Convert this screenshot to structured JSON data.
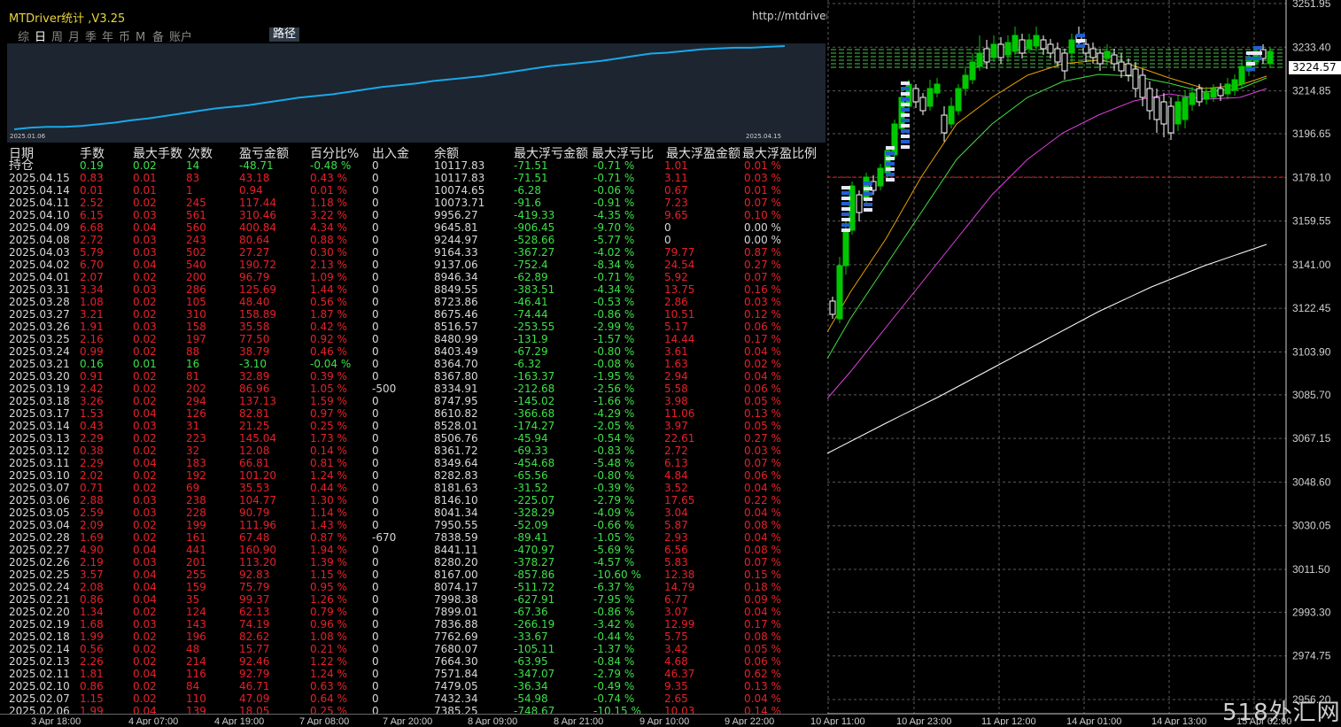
{
  "panel": {
    "title": "MTDriver统计 ,V3.25",
    "url": "http://mtdriver.cn",
    "tabs": [
      "综",
      "日",
      "周",
      "月",
      "季",
      "年",
      "币",
      "M",
      "备",
      "账户"
    ],
    "active_tab": "日",
    "path_button": "路径",
    "equity": {
      "start_date": "2025.01.06",
      "end_date": "2025.04.15",
      "line_color": "#19a8e8",
      "values": [
        0,
        2,
        3,
        3,
        4,
        6,
        8,
        11,
        13,
        16,
        19,
        22,
        25,
        27,
        29,
        32,
        35,
        38,
        40,
        42,
        45,
        48,
        51,
        53,
        55,
        58,
        60,
        62,
        64,
        67,
        70,
        73,
        76,
        78,
        80,
        82,
        85,
        88,
        91,
        92,
        94,
        96,
        97,
        98,
        98,
        99,
        100
      ]
    }
  },
  "table": {
    "headers": [
      "日期",
      "手数",
      "最大手数",
      "次数",
      "盈亏金额",
      "百分比%",
      "出入金",
      "余额",
      "最大浮亏金额",
      "最大浮亏比",
      "最大浮盈金额",
      "最大浮盈比例"
    ],
    "holding": {
      "label": "持仓",
      "lots": "0.19",
      "maxlots": "0.02",
      "count": "14",
      "pnl": "-48.71",
      "pct": "-0.48 %",
      "io": "0",
      "balance": "10117.83",
      "ddamt": "-71.51",
      "ddpct": "-0.71 %",
      "fpamt": "1.01",
      "fppct": "0.01 %"
    },
    "rows": [
      {
        "date": "2025.04.15",
        "lots": "0.83",
        "maxlots": "0.01",
        "count": "83",
        "pnl": "43.18",
        "pct": "0.43 %",
        "io": "0",
        "balance": "10117.83",
        "ddamt": "-71.51",
        "ddpct": "-0.71 %",
        "fpamt": "3.11",
        "fppct": "0.03 %"
      },
      {
        "date": "2025.04.14",
        "lots": "0.01",
        "maxlots": "0.01",
        "count": "1",
        "pnl": "0.94",
        "pct": "0.01 %",
        "io": "0",
        "balance": "10074.65",
        "ddamt": "-6.28",
        "ddpct": "-0.06 %",
        "fpamt": "0.67",
        "fppct": "0.01 %"
      },
      {
        "date": "2025.04.11",
        "lots": "2.52",
        "maxlots": "0.02",
        "count": "245",
        "pnl": "117.44",
        "pct": "1.18 %",
        "io": "0",
        "balance": "10073.71",
        "ddamt": "-91.6",
        "ddpct": "-0.91 %",
        "fpamt": "7.23",
        "fppct": "0.07 %"
      },
      {
        "date": "2025.04.10",
        "lots": "6.15",
        "maxlots": "0.03",
        "count": "561",
        "pnl": "310.46",
        "pct": "3.22 %",
        "io": "0",
        "balance": "9956.27",
        "ddamt": "-419.33",
        "ddpct": "-4.35 %",
        "fpamt": "9.65",
        "fppct": "0.10 %"
      },
      {
        "date": "2025.04.09",
        "lots": "6.68",
        "maxlots": "0.04",
        "count": "560",
        "pnl": "400.84",
        "pct": "4.34 %",
        "io": "0",
        "balance": "9645.81",
        "ddamt": "-906.45",
        "ddpct": "-9.70 %",
        "fpamt": "0",
        "fppct": "0.00 %"
      },
      {
        "date": "2025.04.08",
        "lots": "2.72",
        "maxlots": "0.03",
        "count": "243",
        "pnl": "80.64",
        "pct": "0.88 %",
        "io": "0",
        "balance": "9244.97",
        "ddamt": "-528.66",
        "ddpct": "-5.77 %",
        "fpamt": "0",
        "fppct": "0.00 %"
      },
      {
        "date": "2025.04.03",
        "lots": "5.79",
        "maxlots": "0.03",
        "count": "502",
        "pnl": "27.27",
        "pct": "0.30 %",
        "io": "0",
        "balance": "9164.33",
        "ddamt": "-367.27",
        "ddpct": "-4.02 %",
        "fpamt": "79.77",
        "fppct": "0.87 %"
      },
      {
        "date": "2025.04.02",
        "lots": "6.70",
        "maxlots": "0.04",
        "count": "540",
        "pnl": "190.72",
        "pct": "2.13 %",
        "io": "0",
        "balance": "9137.06",
        "ddamt": "-752.4",
        "ddpct": "-8.34 %",
        "fpamt": "24.54",
        "fppct": "0.27 %"
      },
      {
        "date": "2025.04.01",
        "lots": "2.07",
        "maxlots": "0.02",
        "count": "200",
        "pnl": "96.79",
        "pct": "1.09 %",
        "io": "0",
        "balance": "8946.34",
        "ddamt": "-62.89",
        "ddpct": "-0.71 %",
        "fpamt": "5.92",
        "fppct": "0.07 %"
      },
      {
        "date": "2025.03.31",
        "lots": "3.34",
        "maxlots": "0.03",
        "count": "286",
        "pnl": "125.69",
        "pct": "1.44 %",
        "io": "0",
        "balance": "8849.55",
        "ddamt": "-383.51",
        "ddpct": "-4.34 %",
        "fpamt": "13.75",
        "fppct": "0.16 %"
      },
      {
        "date": "2025.03.28",
        "lots": "1.08",
        "maxlots": "0.02",
        "count": "105",
        "pnl": "48.40",
        "pct": "0.56 %",
        "io": "0",
        "balance": "8723.86",
        "ddamt": "-46.41",
        "ddpct": "-0.53 %",
        "fpamt": "2.86",
        "fppct": "0.03 %"
      },
      {
        "date": "2025.03.27",
        "lots": "3.21",
        "maxlots": "0.02",
        "count": "310",
        "pnl": "158.89",
        "pct": "1.87 %",
        "io": "0",
        "balance": "8675.46",
        "ddamt": "-74.44",
        "ddpct": "-0.86 %",
        "fpamt": "10.51",
        "fppct": "0.12 %"
      },
      {
        "date": "2025.03.26",
        "lots": "1.91",
        "maxlots": "0.03",
        "count": "158",
        "pnl": "35.58",
        "pct": "0.42 %",
        "io": "0",
        "balance": "8516.57",
        "ddamt": "-253.55",
        "ddpct": "-2.99 %",
        "fpamt": "5.17",
        "fppct": "0.06 %"
      },
      {
        "date": "2025.03.25",
        "lots": "2.16",
        "maxlots": "0.02",
        "count": "197",
        "pnl": "77.50",
        "pct": "0.92 %",
        "io": "0",
        "balance": "8480.99",
        "ddamt": "-131.9",
        "ddpct": "-1.57 %",
        "fpamt": "14.44",
        "fppct": "0.17 %"
      },
      {
        "date": "2025.03.24",
        "lots": "0.99",
        "maxlots": "0.02",
        "count": "88",
        "pnl": "38.79",
        "pct": "0.46 %",
        "io": "0",
        "balance": "8403.49",
        "ddamt": "-67.29",
        "ddpct": "-0.80 %",
        "fpamt": "3.61",
        "fppct": "0.04 %"
      },
      {
        "date": "2025.03.21",
        "lots": "0.16",
        "maxlots": "0.01",
        "count": "16",
        "pnl": "-3.10",
        "pct": "-0.04 %",
        "io": "0",
        "balance": "8364.70",
        "ddamt": "-6.32",
        "ddpct": "-0.08 %",
        "fpamt": "1.63",
        "fppct": "0.02 %"
      },
      {
        "date": "2025.03.20",
        "lots": "0.91",
        "maxlots": "0.02",
        "count": "81",
        "pnl": "32.89",
        "pct": "0.39 %",
        "io": "0",
        "balance": "8367.80",
        "ddamt": "-163.37",
        "ddpct": "-1.95 %",
        "fpamt": "2.94",
        "fppct": "0.04 %"
      },
      {
        "date": "2025.03.19",
        "lots": "2.42",
        "maxlots": "0.02",
        "count": "202",
        "pnl": "86.96",
        "pct": "1.05 %",
        "io": "-500",
        "balance": "8334.91",
        "ddamt": "-212.68",
        "ddpct": "-2.56 %",
        "fpamt": "5.58",
        "fppct": "0.06 %"
      },
      {
        "date": "2025.03.18",
        "lots": "3.26",
        "maxlots": "0.02",
        "count": "294",
        "pnl": "137.13",
        "pct": "1.59 %",
        "io": "0",
        "balance": "8747.95",
        "ddamt": "-145.02",
        "ddpct": "-1.66 %",
        "fpamt": "3.98",
        "fppct": "0.05 %"
      },
      {
        "date": "2025.03.17",
        "lots": "1.53",
        "maxlots": "0.04",
        "count": "126",
        "pnl": "82.81",
        "pct": "0.97 %",
        "io": "0",
        "balance": "8610.82",
        "ddamt": "-366.68",
        "ddpct": "-4.29 %",
        "fpamt": "11.06",
        "fppct": "0.13 %"
      },
      {
        "date": "2025.03.14",
        "lots": "0.43",
        "maxlots": "0.03",
        "count": "31",
        "pnl": "21.25",
        "pct": "0.25 %",
        "io": "0",
        "balance": "8528.01",
        "ddamt": "-174.27",
        "ddpct": "-2.05 %",
        "fpamt": "3.97",
        "fppct": "0.05 %"
      },
      {
        "date": "2025.03.13",
        "lots": "2.29",
        "maxlots": "0.02",
        "count": "223",
        "pnl": "145.04",
        "pct": "1.73 %",
        "io": "0",
        "balance": "8506.76",
        "ddamt": "-45.94",
        "ddpct": "-0.54 %",
        "fpamt": "22.61",
        "fppct": "0.27 %"
      },
      {
        "date": "2025.03.12",
        "lots": "0.38",
        "maxlots": "0.02",
        "count": "32",
        "pnl": "12.08",
        "pct": "0.14 %",
        "io": "0",
        "balance": "8361.72",
        "ddamt": "-69.33",
        "ddpct": "-0.83 %",
        "fpamt": "2.72",
        "fppct": "0.03 %"
      },
      {
        "date": "2025.03.11",
        "lots": "2.29",
        "maxlots": "0.04",
        "count": "183",
        "pnl": "66.81",
        "pct": "0.81 %",
        "io": "0",
        "balance": "8349.64",
        "ddamt": "-454.68",
        "ddpct": "-5.48 %",
        "fpamt": "6.13",
        "fppct": "0.07 %"
      },
      {
        "date": "2025.03.10",
        "lots": "2.02",
        "maxlots": "0.02",
        "count": "192",
        "pnl": "101.20",
        "pct": "1.24 %",
        "io": "0",
        "balance": "8282.83",
        "ddamt": "-65.56",
        "ddpct": "-0.80 %",
        "fpamt": "4.84",
        "fppct": "0.06 %"
      },
      {
        "date": "2025.03.07",
        "lots": "0.71",
        "maxlots": "0.02",
        "count": "69",
        "pnl": "35.53",
        "pct": "0.44 %",
        "io": "0",
        "balance": "8181.63",
        "ddamt": "-31.52",
        "ddpct": "-0.39 %",
        "fpamt": "3.52",
        "fppct": "0.04 %"
      },
      {
        "date": "2025.03.06",
        "lots": "2.88",
        "maxlots": "0.03",
        "count": "238",
        "pnl": "104.77",
        "pct": "1.30 %",
        "io": "0",
        "balance": "8146.10",
        "ddamt": "-225.07",
        "ddpct": "-2.79 %",
        "fpamt": "17.65",
        "fppct": "0.22 %"
      },
      {
        "date": "2025.03.05",
        "lots": "2.59",
        "maxlots": "0.03",
        "count": "228",
        "pnl": "90.79",
        "pct": "1.14 %",
        "io": "0",
        "balance": "8041.34",
        "ddamt": "-328.29",
        "ddpct": "-4.09 %",
        "fpamt": "3.04",
        "fppct": "0.04 %"
      },
      {
        "date": "2025.03.04",
        "lots": "2.09",
        "maxlots": "0.02",
        "count": "199",
        "pnl": "111.96",
        "pct": "1.43 %",
        "io": "0",
        "balance": "7950.55",
        "ddamt": "-52.09",
        "ddpct": "-0.66 %",
        "fpamt": "5.87",
        "fppct": "0.08 %"
      },
      {
        "date": "2025.02.28",
        "lots": "1.69",
        "maxlots": "0.02",
        "count": "161",
        "pnl": "67.48",
        "pct": "0.87 %",
        "io": "-670",
        "balance": "7838.59",
        "ddamt": "-89.41",
        "ddpct": "-1.05 %",
        "fpamt": "2.93",
        "fppct": "0.04 %"
      },
      {
        "date": "2025.02.27",
        "lots": "4.90",
        "maxlots": "0.04",
        "count": "441",
        "pnl": "160.90",
        "pct": "1.94 %",
        "io": "0",
        "balance": "8441.11",
        "ddamt": "-470.97",
        "ddpct": "-5.69 %",
        "fpamt": "6.56",
        "fppct": "0.08 %"
      },
      {
        "date": "2025.02.26",
        "lots": "2.19",
        "maxlots": "0.03",
        "count": "201",
        "pnl": "113.20",
        "pct": "1.39 %",
        "io": "0",
        "balance": "8280.20",
        "ddamt": "-378.27",
        "ddpct": "-4.57 %",
        "fpamt": "5.83",
        "fppct": "0.07 %"
      },
      {
        "date": "2025.02.25",
        "lots": "3.57",
        "maxlots": "0.04",
        "count": "255",
        "pnl": "92.83",
        "pct": "1.15 %",
        "io": "0",
        "balance": "8167.00",
        "ddamt": "-857.86",
        "ddpct": "-10.60 %",
        "fpamt": "12.38",
        "fppct": "0.15 %"
      },
      {
        "date": "2025.02.24",
        "lots": "2.08",
        "maxlots": "0.04",
        "count": "159",
        "pnl": "75.79",
        "pct": "0.95 %",
        "io": "0",
        "balance": "8074.17",
        "ddamt": "-511.72",
        "ddpct": "-6.37 %",
        "fpamt": "14.79",
        "fppct": "0.18 %"
      },
      {
        "date": "2025.02.21",
        "lots": "0.86",
        "maxlots": "0.04",
        "count": "35",
        "pnl": "99.37",
        "pct": "1.26 %",
        "io": "0",
        "balance": "7998.38",
        "ddamt": "-627.91",
        "ddpct": "-7.95 %",
        "fpamt": "6.77",
        "fppct": "0.09 %"
      },
      {
        "date": "2025.02.20",
        "lots": "1.34",
        "maxlots": "0.02",
        "count": "124",
        "pnl": "62.13",
        "pct": "0.79 %",
        "io": "0",
        "balance": "7899.01",
        "ddamt": "-67.36",
        "ddpct": "-0.86 %",
        "fpamt": "3.07",
        "fppct": "0.04 %"
      },
      {
        "date": "2025.02.19",
        "lots": "1.68",
        "maxlots": "0.03",
        "count": "143",
        "pnl": "74.19",
        "pct": "0.96 %",
        "io": "0",
        "balance": "7836.88",
        "ddamt": "-266.19",
        "ddpct": "-3.42 %",
        "fpamt": "12.99",
        "fppct": "0.17 %"
      },
      {
        "date": "2025.02.18",
        "lots": "1.99",
        "maxlots": "0.02",
        "count": "196",
        "pnl": "82.62",
        "pct": "1.08 %",
        "io": "0",
        "balance": "7762.69",
        "ddamt": "-33.67",
        "ddpct": "-0.44 %",
        "fpamt": "5.75",
        "fppct": "0.08 %"
      },
      {
        "date": "2025.02.14",
        "lots": "0.56",
        "maxlots": "0.02",
        "count": "48",
        "pnl": "15.77",
        "pct": "0.21 %",
        "io": "0",
        "balance": "7680.07",
        "ddamt": "-105.11",
        "ddpct": "-1.37 %",
        "fpamt": "3.42",
        "fppct": "0.05 %"
      },
      {
        "date": "2025.02.13",
        "lots": "2.26",
        "maxlots": "0.02",
        "count": "214",
        "pnl": "92.46",
        "pct": "1.22 %",
        "io": "0",
        "balance": "7664.30",
        "ddamt": "-63.95",
        "ddpct": "-0.84 %",
        "fpamt": "4.68",
        "fppct": "0.06 %"
      },
      {
        "date": "2025.02.11",
        "lots": "1.81",
        "maxlots": "0.04",
        "count": "116",
        "pnl": "92.79",
        "pct": "1.24 %",
        "io": "0",
        "balance": "7571.84",
        "ddamt": "-347.07",
        "ddpct": "-2.79 %",
        "fpamt": "46.37",
        "fppct": "0.62 %"
      },
      {
        "date": "2025.02.10",
        "lots": "0.86",
        "maxlots": "0.02",
        "count": "84",
        "pnl": "46.71",
        "pct": "0.63 %",
        "io": "0",
        "balance": "7479.05",
        "ddamt": "-36.34",
        "ddpct": "-0.49 %",
        "fpamt": "9.35",
        "fppct": "0.13 %"
      },
      {
        "date": "2025.02.07",
        "lots": "1.15",
        "maxlots": "0.02",
        "count": "110",
        "pnl": "47.09",
        "pct": "0.64 %",
        "io": "0",
        "balance": "7432.34",
        "ddamt": "-54.98",
        "ddpct": "-0.74 %",
        "fpamt": "2.65",
        "fppct": "0.04 %"
      },
      {
        "date": "2025.02.06",
        "lots": "1.99",
        "maxlots": "0.04",
        "count": "139",
        "pnl": "18.05",
        "pct": "0.25 %",
        "io": "0",
        "balance": "7385.25",
        "ddamt": "-748.67",
        "ddpct": "-10.15 %",
        "fpamt": "10.03",
        "fppct": "0.14 %"
      }
    ]
  },
  "price_chart": {
    "current_price": "3224.57",
    "price_axis": [
      "3251.95",
      "3233.40",
      "3214.85",
      "3196.65",
      "3178.10",
      "3159.55",
      "3141.00",
      "3122.45",
      "3103.90",
      "3085.70",
      "3067.15",
      "3048.60",
      "3030.05",
      "3011.50",
      "2993.30",
      "2974.75",
      "2956.20"
    ],
    "time_axis": [
      "3 Apr 18:00",
      "4 Apr 07:00",
      "4 Apr 19:00",
      "7 Apr 08:00",
      "7 Apr 20:00",
      "8 Apr 09:00",
      "8 Apr 21:00",
      "9 Apr 10:00",
      "9 Apr 22:00",
      "10 Apr 11:00",
      "10 Apr 23:00",
      "11 Apr 12:00",
      "14 Apr 01:00",
      "14 Apr 13:00",
      "15 Apr 02:00"
    ],
    "colors": {
      "bull": "#00c800",
      "bear": "#ffffff",
      "ma_fast": "#e8a000",
      "ma_mid": "#40e040",
      "ma_slow": "#e040e0",
      "ma_long": "#ffffff",
      "red_line": "#d02020"
    }
  },
  "watermark": "518外汇网"
}
